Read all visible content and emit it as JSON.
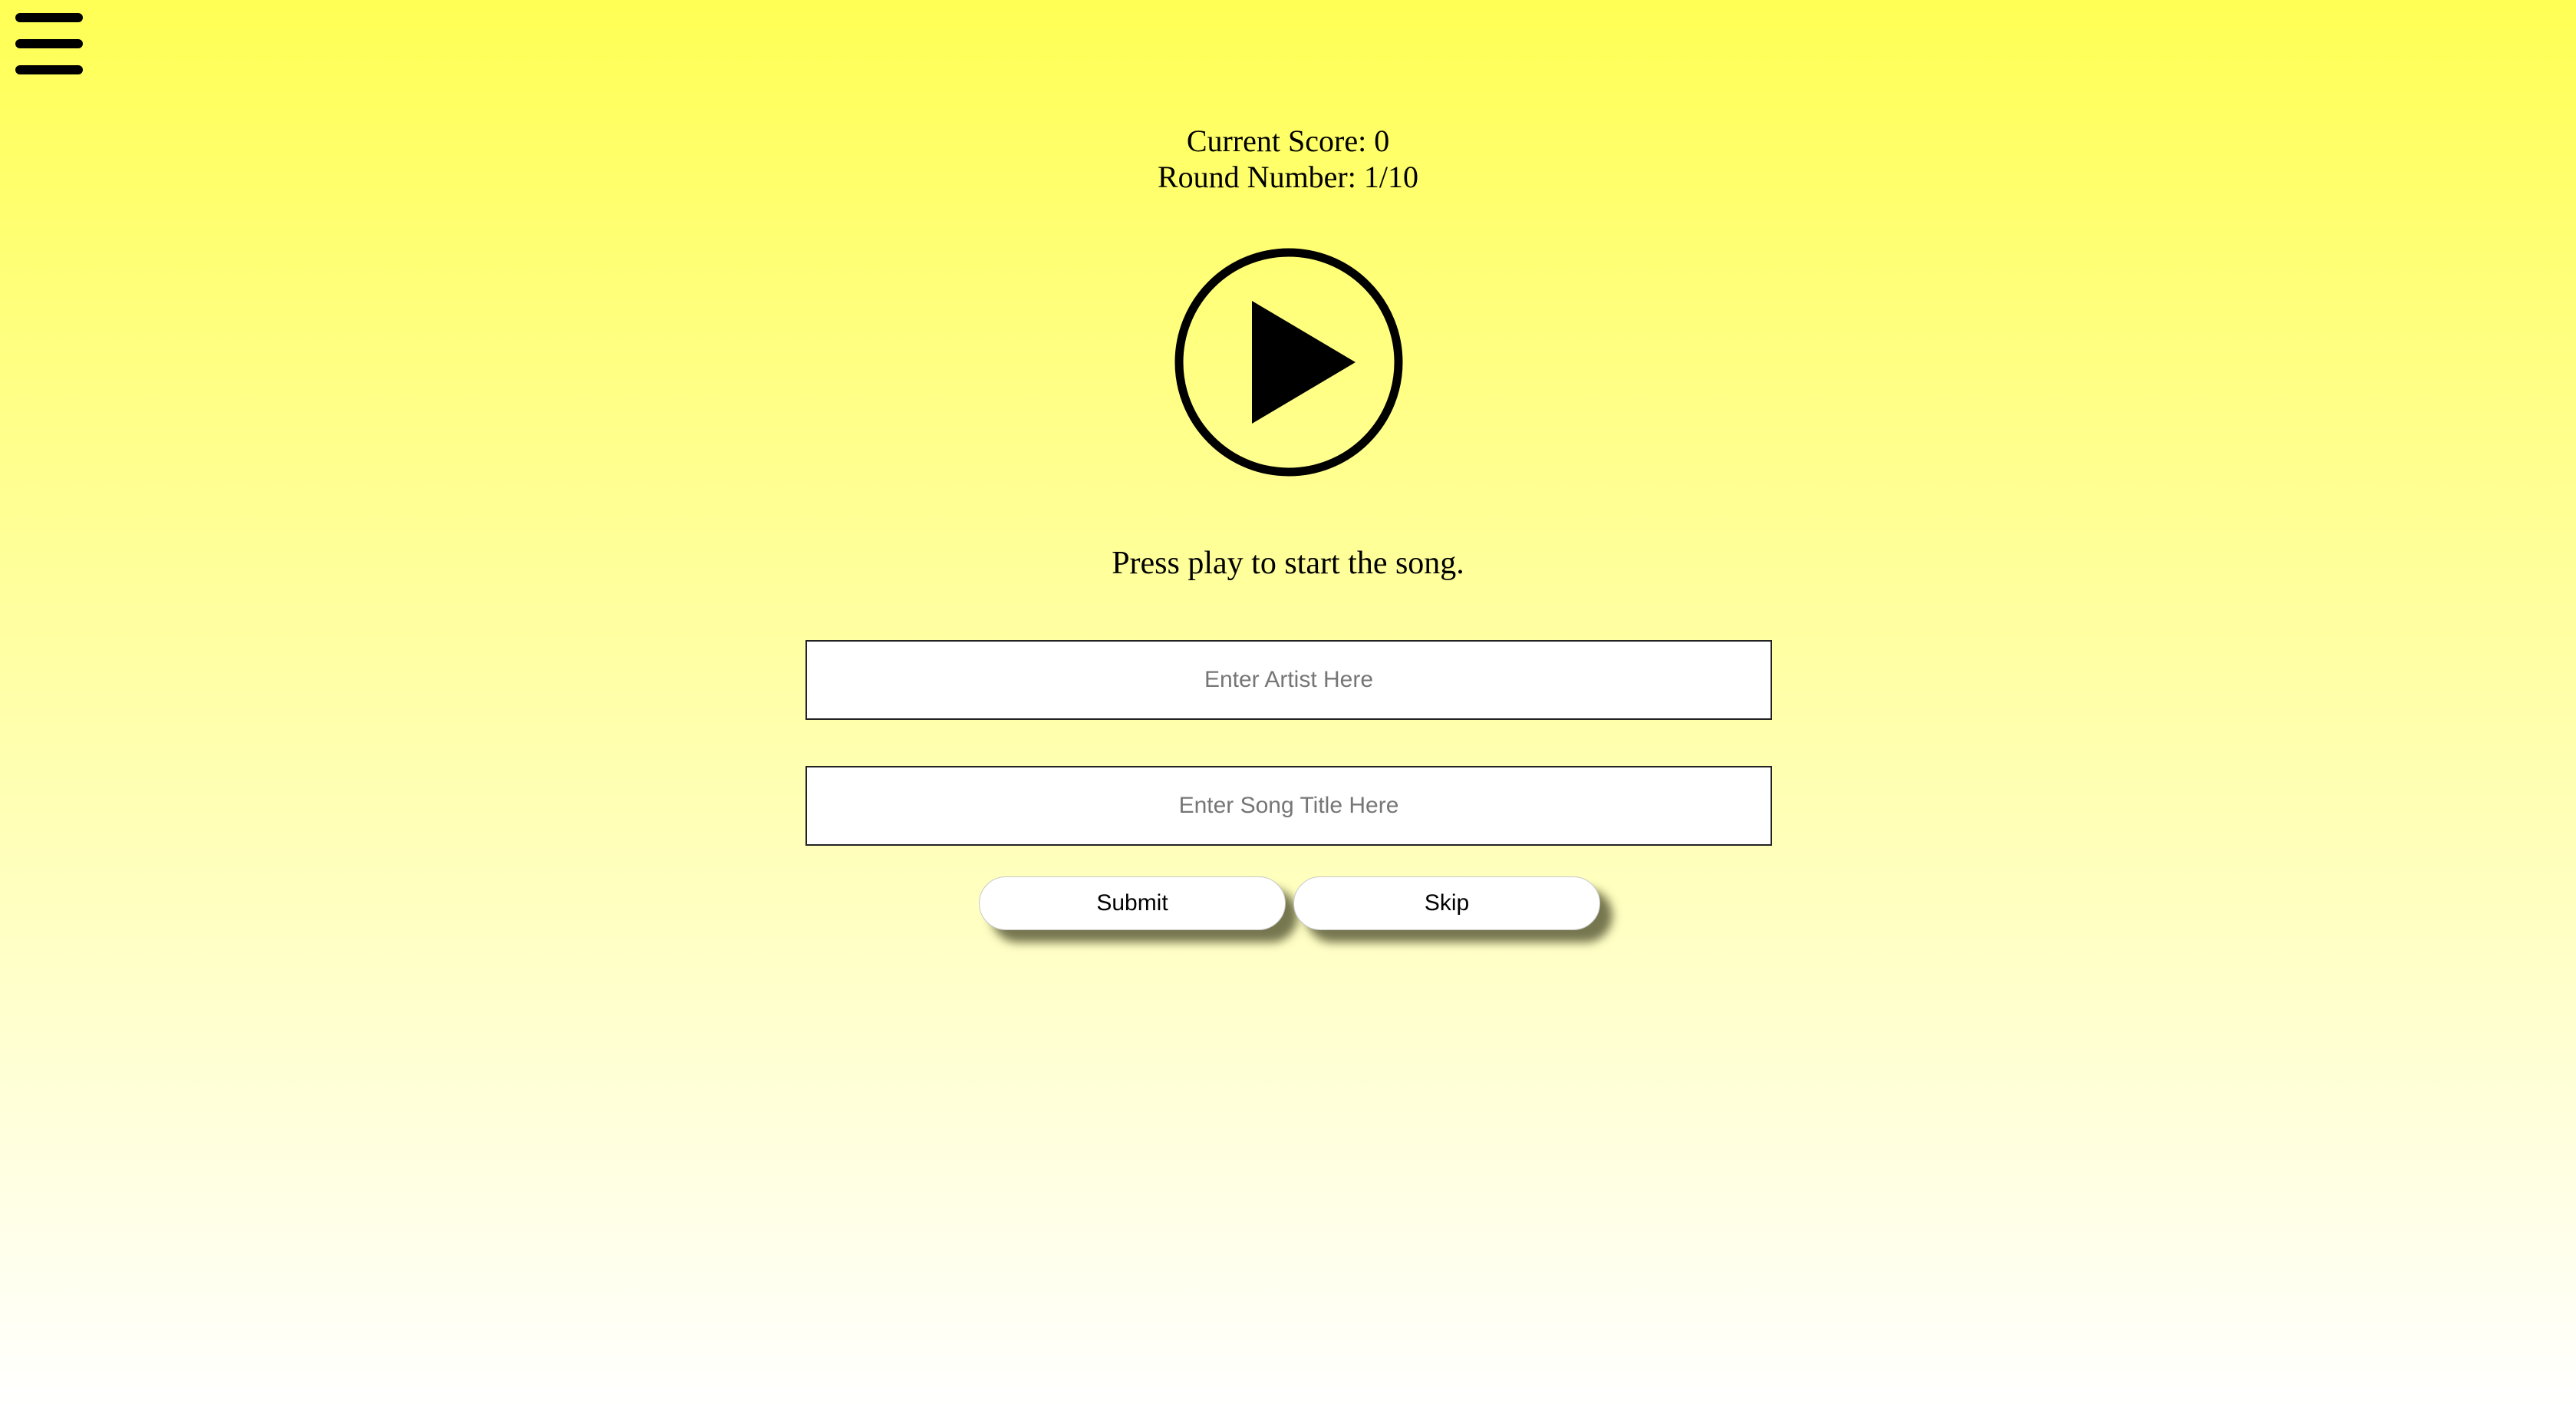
{
  "nav": {
    "menu_icon": "hamburger-menu-icon"
  },
  "game": {
    "score_text": "Current Score: 0",
    "round_text": "Round Number: 1/10",
    "play_icon": "play-circle-icon",
    "status": "Press play to start the song."
  },
  "form": {
    "artist_placeholder": "Enter Artist Here",
    "artist_value": "",
    "title_placeholder": "Enter Song Title Here",
    "title_value": "",
    "submit_label": "Submit",
    "skip_label": "Skip"
  },
  "colors": {
    "background_top": "#ffff55",
    "background_bottom": "#ffffff",
    "button_bg": "#ffffff"
  }
}
